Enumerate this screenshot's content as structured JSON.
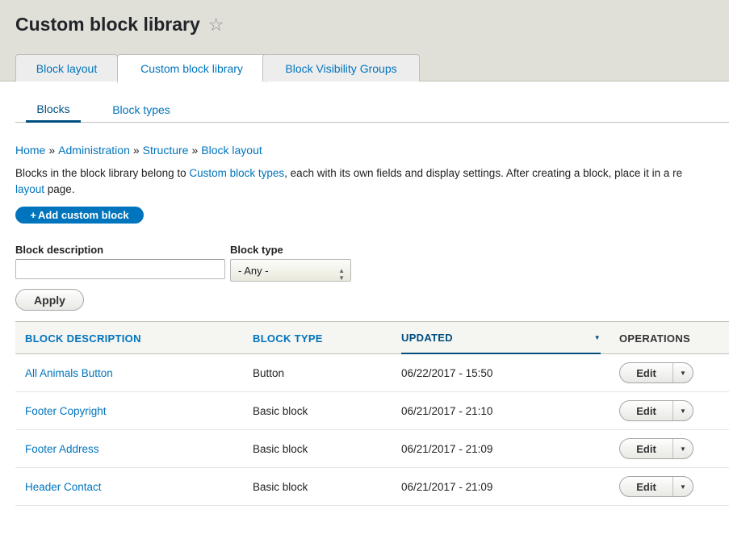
{
  "header": {
    "title": "Custom block library",
    "tabs": [
      "Block layout",
      "Custom block library",
      "Block Visibility Groups"
    ],
    "active_tab": "Custom block library"
  },
  "subtabs": [
    "Blocks",
    "Block types"
  ],
  "breadcrumb": [
    "Home",
    "Administration",
    "Structure",
    "Block layout"
  ],
  "breadcrumb_separator": "»",
  "description": {
    "before_link": "Blocks in the block library belong to ",
    "link": "Custom block types",
    "after_link": ", each with its own fields and display settings. After creating a block, place it in a re",
    "line2": "layout",
    "line2_after": " page."
  },
  "add_button": "Add custom block",
  "filters": {
    "description_label": "Block description",
    "description_value": "",
    "type_label": "Block type",
    "type_value": "- Any -",
    "apply_label": "Apply"
  },
  "table": {
    "headers": [
      "BLOCK DESCRIPTION",
      "BLOCK TYPE",
      "UPDATED",
      "OPERATIONS"
    ],
    "sorted_column": "UPDATED",
    "rows": [
      {
        "description": "All Animals Button",
        "type": "Button",
        "updated": "06/22/2017 - 15:50",
        "op": "Edit"
      },
      {
        "description": "Footer Copyright",
        "type": "Basic block",
        "updated": "06/21/2017 - 21:10",
        "op": "Edit"
      },
      {
        "description": "Footer Address",
        "type": "Basic block",
        "updated": "06/21/2017 - 21:09",
        "op": "Edit"
      },
      {
        "description": "Header Contact",
        "type": "Basic block",
        "updated": "06/21/2017 - 21:09",
        "op": "Edit"
      }
    ]
  },
  "colors": {
    "link": "#0074bd",
    "header_bg": "#e0e0d8",
    "primary_button": "#0074bd"
  }
}
